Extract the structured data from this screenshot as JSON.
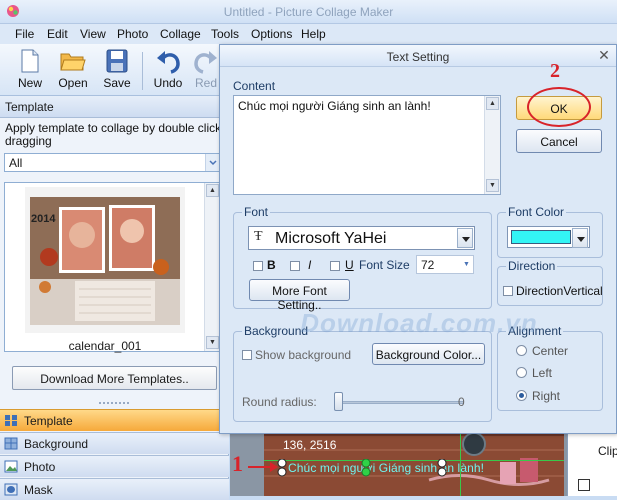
{
  "app": {
    "title": "Untitled - Picture Collage Maker"
  },
  "menu": [
    "File",
    "Edit",
    "View",
    "Photo",
    "Collage",
    "Tools",
    "Options",
    "Help"
  ],
  "toolbar": {
    "new": "New",
    "open": "Open",
    "save": "Save",
    "undo": "Undo",
    "redo": "Red"
  },
  "left_panel": {
    "header": "Template",
    "help_line1": "Apply template to collage by double clicking o",
    "help_line2": "dragging",
    "category": "All",
    "thumb_year": "2014",
    "thumb_name": "calendar_001",
    "download_button": "Download More Templates..",
    "tabs": [
      "Template",
      "Background",
      "Photo",
      "Mask"
    ]
  },
  "canvas": {
    "coords": "136, 2516",
    "text": "Chúc mọi người Giáng sinh an lành!",
    "marker": "1",
    "clip_label": "Clip"
  },
  "dialog": {
    "title": "Text Setting",
    "content_label": "Content",
    "content_text": "Chúc mọi người Giáng sinh an lành!",
    "ok": "OK",
    "cancel": "Cancel",
    "step_marker": "2",
    "font_group": "Font",
    "font_name": "Microsoft YaHei",
    "bold": "B",
    "italic": "I",
    "underline": "U",
    "font_size_label": "Font Size",
    "font_size": "72",
    "more_font": "More Font Setting..",
    "font_color_group": "Font Color",
    "font_color": "#33f5f5",
    "direction_group": "Direction",
    "direction_vertical": "DirectionVertical",
    "background_group": "Background",
    "show_background": "Show background",
    "background_color_button": "Background Color...",
    "round_radius_label": "Round radius:",
    "round_radius_value": "0",
    "alignment_group": "Alignment",
    "align_center": "Center",
    "align_left": "Left",
    "align_right": "Right",
    "watermark": "Download.com.vn"
  }
}
